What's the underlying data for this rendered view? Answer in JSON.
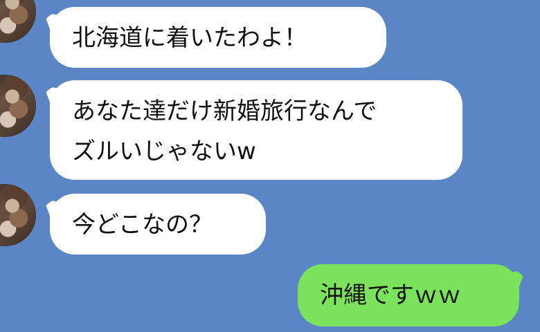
{
  "messages": [
    {
      "side": "left",
      "lines": [
        "北海道に着いたわよ！"
      ]
    },
    {
      "side": "left",
      "lines": [
        "あなた達だけ新婚旅行なんで",
        "ズルいじゃないw"
      ]
    },
    {
      "side": "left",
      "lines": [
        "今どこなの？"
      ]
    },
    {
      "side": "right",
      "lines": [
        "沖縄ですｗｗ"
      ]
    }
  ],
  "colors": {
    "background": "#5b86c5",
    "incoming_bubble": "#ffffff",
    "outgoing_bubble": "#7be35b",
    "text": "#111111"
  },
  "icons": {
    "avatar": "profile-photo-avatar"
  }
}
